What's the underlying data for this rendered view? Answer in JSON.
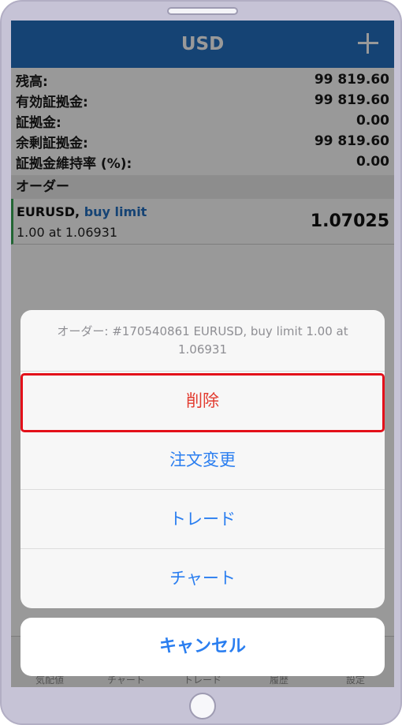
{
  "header": {
    "title": "USD",
    "add_icon": "plus-icon"
  },
  "account": {
    "rows": [
      {
        "label": "残高:",
        "value": "99 819.60"
      },
      {
        "label": "有効証拠金:",
        "value": "99 819.60"
      },
      {
        "label": "証拠金:",
        "value": "0.00"
      },
      {
        "label": "余剰証拠金:",
        "value": "99 819.60"
      },
      {
        "label": "証拠金維持率 (%):",
        "value": "0.00"
      }
    ]
  },
  "orders": {
    "section_title": "オーダー",
    "item": {
      "symbol": "EURUSD,",
      "type": "buy limit",
      "detail": "1.00 at 1.06931",
      "price": "1.07025"
    }
  },
  "tabbar": {
    "tabs": [
      {
        "label": "気配値"
      },
      {
        "label": "チャート"
      },
      {
        "label": "トレード"
      },
      {
        "label": "履歴"
      },
      {
        "label": "設定"
      }
    ]
  },
  "action_sheet": {
    "message": "オーダー: #170540861 EURUSD, buy limit 1.00 at 1.06931",
    "actions": [
      {
        "label": "削除"
      },
      {
        "label": "注文変更"
      },
      {
        "label": "トレード"
      },
      {
        "label": "チャート"
      }
    ],
    "cancel_label": "キャンセル"
  },
  "colors": {
    "navbar": "#2470c2",
    "action_blue": "#2a7ef0",
    "destructive_red": "#e23b2f",
    "highlight_red": "#e3101a",
    "order_marker_green": "#3aaa55"
  }
}
